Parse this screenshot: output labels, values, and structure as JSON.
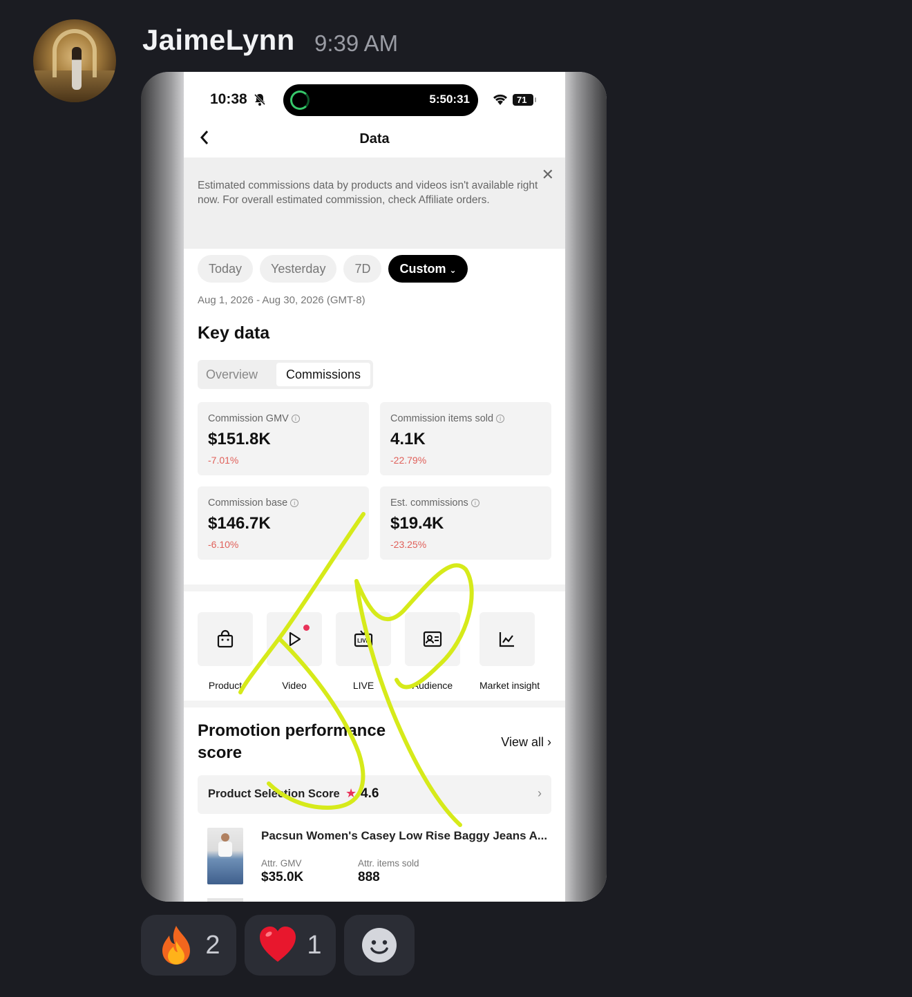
{
  "message": {
    "username": "JaimeLynn",
    "timestamp": "9:39 AM"
  },
  "phone": {
    "status": {
      "time": "10:38",
      "timer": "5:50:31",
      "battery": "71"
    },
    "nav": {
      "title": "Data"
    },
    "notice": "Estimated commissions data by products and videos isn't available right now. For overall estimated commission, check Affiliate orders.",
    "range_tabs": [
      "Today",
      "Yesterday",
      "7D",
      "Custom"
    ],
    "active_range": "Custom",
    "date_range": "Aug 1, 2026 - Aug 30, 2026 (GMT-8)",
    "key_data": {
      "title": "Key data",
      "tabs": [
        "Overview",
        "Commissions"
      ],
      "active_tab": "Commissions",
      "cards": [
        {
          "label": "Commission GMV",
          "value": "$151.8K",
          "change": "-7.01%"
        },
        {
          "label": "Commission items sold",
          "value": "4.1K",
          "change": "-22.79%"
        },
        {
          "label": "Commission base",
          "value": "$146.7K",
          "change": "-6.10%"
        },
        {
          "label": "Est. commissions",
          "value": "$19.4K",
          "change": "-23.25%"
        }
      ]
    },
    "tools": [
      {
        "label": "Product",
        "icon": "shopping-bag-icon"
      },
      {
        "label": "Video",
        "icon": "video-play-icon"
      },
      {
        "label": "LIVE",
        "icon": "live-tv-icon"
      },
      {
        "label": "Audience",
        "icon": "audience-card-icon"
      },
      {
        "label": "Market insight",
        "icon": "line-chart-icon"
      }
    ],
    "promotion": {
      "title": "Promotion performance score",
      "view_all": "View all",
      "score_label": "Product Selection Score",
      "score_value": "4.6"
    },
    "product": {
      "name": "Pacsun Women's Casey Low Rise Baggy Jeans A...",
      "gmv_label": "Attr. GMV",
      "gmv_value": "$35.0K",
      "items_label": "Attr. items sold",
      "items_value": "888"
    }
  },
  "reactions": [
    {
      "emoji": "fire",
      "count": "2"
    },
    {
      "emoji": "heart",
      "count": "1"
    },
    {
      "emoji": "add-reaction"
    }
  ],
  "colors": {
    "background": "#1b1c22",
    "signature": "#d6ea1a",
    "negative_change": "#e0605a",
    "live_dot": "#e8335a"
  }
}
